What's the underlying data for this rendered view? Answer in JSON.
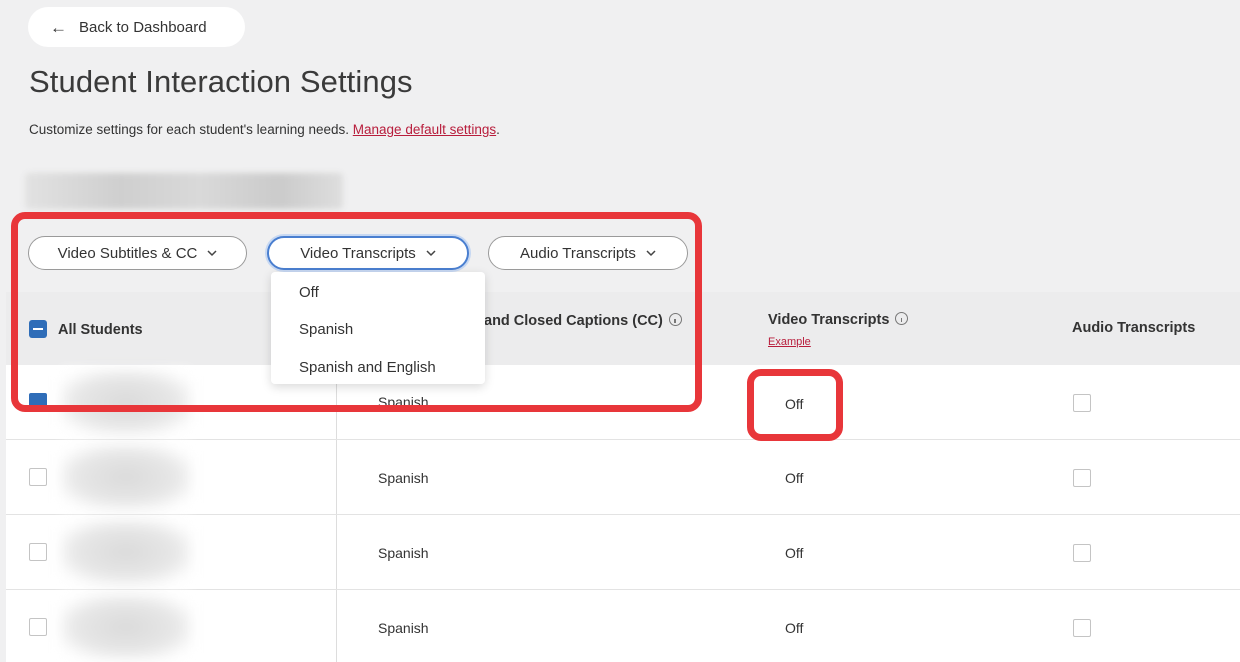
{
  "back_button": {
    "label": "Back to Dashboard"
  },
  "page": {
    "title": "Student Interaction Settings",
    "subtitle": "Customize settings for each student's learning needs.",
    "manage_link": "Manage default settings"
  },
  "filters": [
    {
      "label": "Video Subtitles & CC"
    },
    {
      "label": "Video Transcripts"
    },
    {
      "label": "Audio Transcripts"
    }
  ],
  "dropdown": {
    "options": [
      "Off",
      "Spanish",
      "Spanish and English"
    ]
  },
  "table": {
    "headers": {
      "students": "All Students",
      "subtitles": "and Closed Captions (CC)",
      "video_transcripts": "Video Transcripts",
      "example_link": "Example",
      "audio_transcripts": "Audio Transcripts"
    },
    "rows": [
      {
        "subtitles": "Spanish",
        "video_transcripts": "Off",
        "checked": true
      },
      {
        "subtitles": "Spanish",
        "video_transcripts": "Off",
        "checked": false
      },
      {
        "subtitles": "Spanish",
        "video_transcripts": "Off",
        "checked": false
      },
      {
        "subtitles": "Spanish",
        "video_transcripts": "Off",
        "checked": false
      }
    ]
  },
  "colors": {
    "annotation": "#e8363a",
    "accent": "#2f6db8",
    "link": "#b81d3c"
  },
  "icons": [
    "arrow-left-icon",
    "chevron-down-icon",
    "info-icon",
    "checkbox-icon"
  ]
}
